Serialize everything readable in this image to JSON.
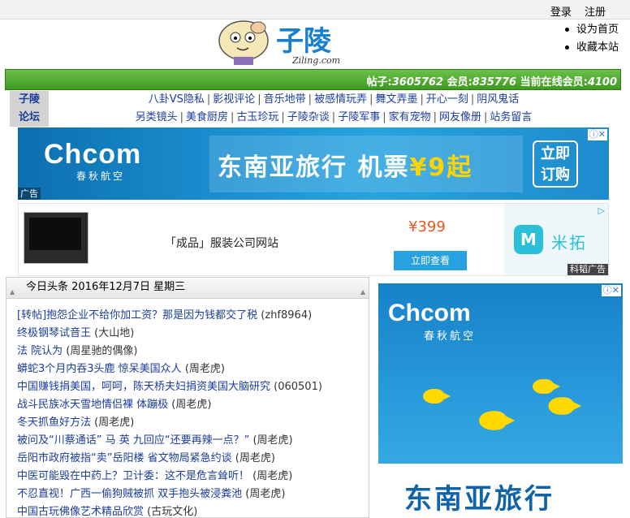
{
  "top": {
    "login": "登录",
    "register": "注册"
  },
  "logo": {
    "name": "子陵",
    "domain": "Ziling.com"
  },
  "side_links": [
    "设为首页",
    "收藏本站"
  ],
  "stats": {
    "posts_label": "帖子:",
    "posts": "3605762",
    "members_label": "会员:",
    "members": "835776",
    "online_label": "当前在线会员:",
    "online": "4100"
  },
  "nav": {
    "site": [
      "子陵",
      "论坛"
    ],
    "row1": [
      "八卦VS隐私",
      "影视评论",
      "音乐地带",
      "被感情玩弄",
      "舞文弄墨",
      "开心一刻",
      "阴风鬼话"
    ],
    "row2": [
      "另类镜头",
      "美食厨房",
      "古玉珍玩",
      "子陵杂谈",
      "子陵军事",
      "家有宠物",
      "网友像册",
      "站务留言"
    ]
  },
  "banner1": {
    "brand": "Chcom",
    "brand_sub": "春秋航空",
    "headline": "东南亚旅行 机票",
    "price": "¥9起",
    "button": "立即订购",
    "ad_label": "广告",
    "close": "ⓘ✕"
  },
  "banner2": {
    "title": "「成品」服装公司网站",
    "price": "¥399",
    "button": "立即查看",
    "brand_mark": "M",
    "brand": "米拓",
    "ad_label": "科韬广告",
    "play": "▷"
  },
  "news": {
    "header": "今日头条   2016年12月7日   星期三",
    "items": [
      {
        "title": "[转帖]抱怨企业不给你加工资？那是因为钱都交了税",
        "author": "(zhf8964)"
      },
      {
        "title": "终极钢琴试音王",
        "author": "(大山地)"
      },
      {
        "title": "法 院认为",
        "author": "(周星驰的偶像)"
      },
      {
        "title": "蟒蛇3个月内吞3头鹿 惊呆美国众人",
        "author": "(周老虎)"
      },
      {
        "title": "中国赚钱捐美国，呵呵，陈天桥夫妇捐资美国大脑研究",
        "author": "(060501)"
      },
      {
        "title": "战斗民族冰天雪地情侣裸 体蹦极",
        "author": "(周老虎)"
      },
      {
        "title": "冬天抓鱼好方法",
        "author": "(周老虎)"
      },
      {
        "title": "被问及“川蔡通话” 马 英 九回应“还要再辣一点？”",
        "author": "(周老虎)"
      },
      {
        "title": "岳阳市政府被指“卖”岳阳楼 省文物局紧急约谈",
        "author": "(周老虎)"
      },
      {
        "title": "中医可能毁在中药上？卫计委：这不是危言耸听！",
        "author": "(周老虎)"
      },
      {
        "title": "不忍直视！广西一偷狗贼被抓 双手抱头被浸粪池",
        "author": "(周老虎)"
      },
      {
        "title": "中国古玩佛像艺术精品欣赏",
        "author": "(古玩文化)"
      }
    ]
  },
  "right_ad": {
    "brand": "Chcom",
    "brand_sub": "春秋航空",
    "headline": "东南亚旅行",
    "close": "ⓘ✕"
  },
  "colors": {
    "green": "#3d9a1f",
    "link": "#1a3c9c",
    "ad_blue": "#1b8fd0"
  }
}
